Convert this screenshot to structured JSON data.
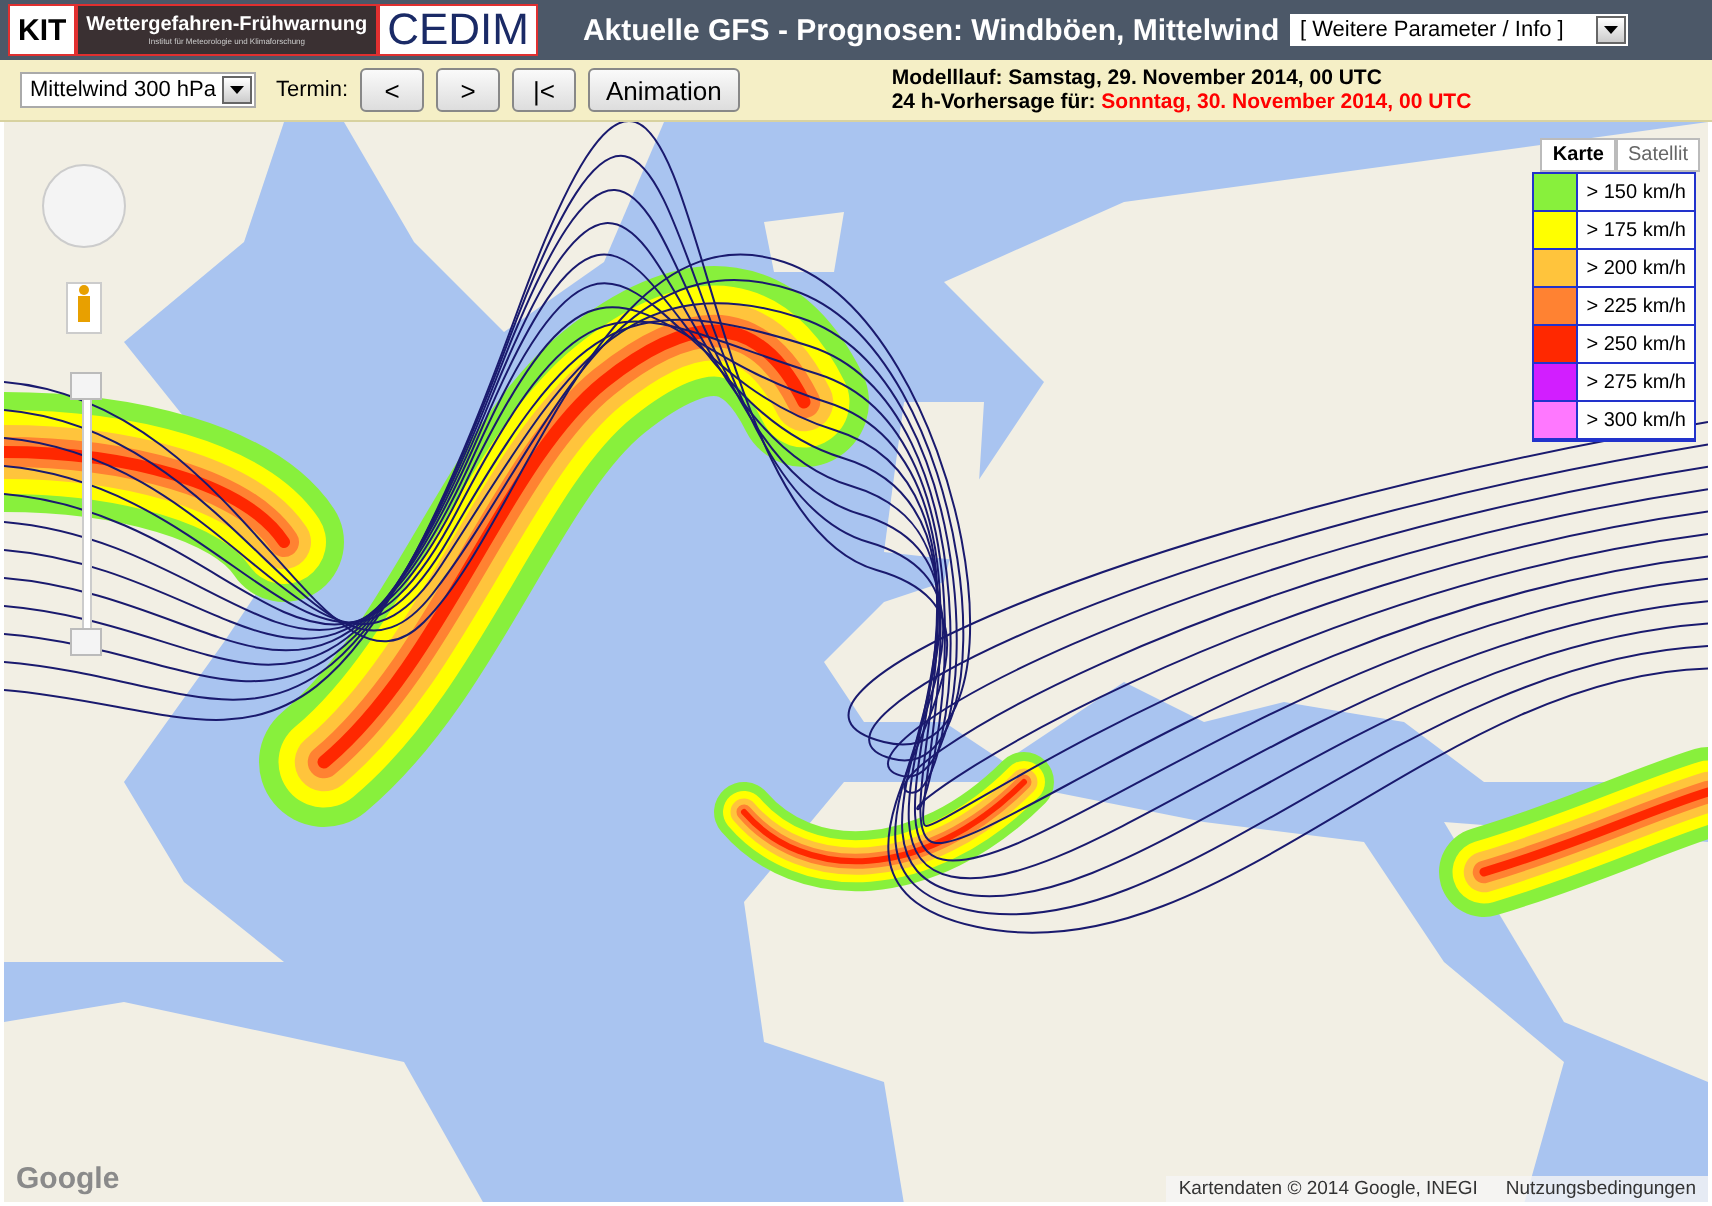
{
  "header": {
    "logos": [
      {
        "kind": "kit",
        "text": "KIT"
      },
      {
        "kind": "banner",
        "text": "Wettergefahren-Frühwarnung",
        "subtext": "Institut für Meteorologie und Klimaforschung"
      },
      {
        "kind": "cedim",
        "text": "CEDIM"
      }
    ],
    "title": "Aktuelle GFS - Prognosen: Windböen, Mittelwind",
    "info_select": "[ Weitere Parameter / Info ]"
  },
  "toolbar": {
    "level_select": "Mittelwind 300 hPa",
    "termin_label": "Termin:",
    "buttons": [
      "<",
      ">",
      "|<",
      "Animation"
    ],
    "model_run": {
      "label": "Modelllauf:",
      "value": "Samstag, 29. November 2014, 00 UTC"
    },
    "forecast": {
      "label": "24 h-Vorhersage für:",
      "value": "Sonntag, 30. November 2014, 00 UTC"
    }
  },
  "map": {
    "map_type_tabs": [
      {
        "label": "Karte",
        "selected": true
      },
      {
        "label": "Satellit",
        "selected": false
      }
    ],
    "legend": [
      {
        "label": "> 150 km/h",
        "color": "#88f03c"
      },
      {
        "label": "> 175 km/h",
        "color": "#ffff00"
      },
      {
        "label": "> 200 km/h",
        "color": "#ffc43c"
      },
      {
        "label": "> 225 km/h",
        "color": "#ff8232"
      },
      {
        "label": "> 250 km/h",
        "color": "#ff2800"
      },
      {
        "label": "> 275 km/h",
        "color": "#d21eff"
      },
      {
        "label": "> 300 km/h",
        "color": "#ff78ff"
      }
    ],
    "logo": "Google",
    "attribution": "Kartendaten © 2014 Google, INEGI",
    "terms": "Nutzungsbedingungen"
  }
}
